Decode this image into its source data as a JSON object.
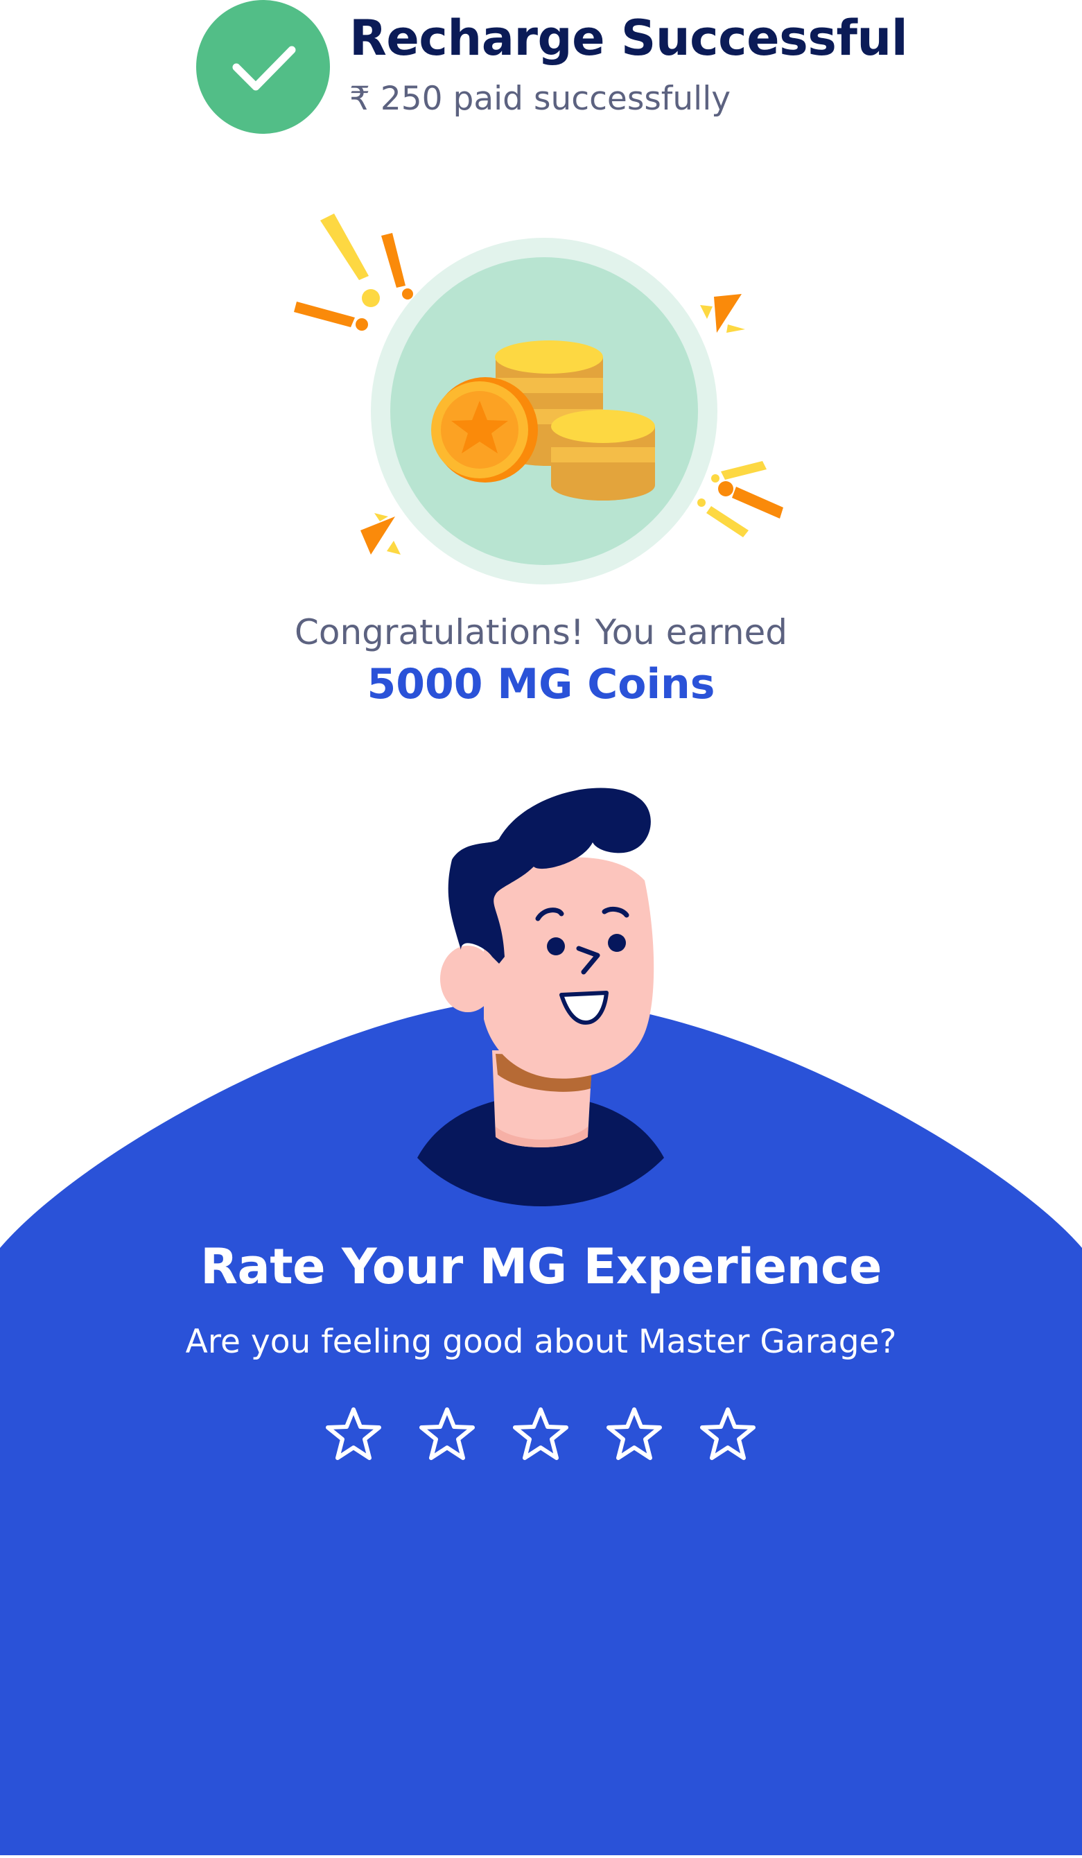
{
  "header": {
    "title": "Recharge Successful",
    "subtitle": "₹ 250 paid successfully",
    "icon": "check-circle-icon"
  },
  "reward": {
    "congrats_text": "Congratulations! You earned",
    "coins_text": "5000 MG Coins",
    "illustration": "coins-illustration"
  },
  "rating": {
    "title": "Rate Your MG Experience",
    "question": "Are you feeling good about Master Garage?",
    "max_stars": 5,
    "selected_stars": 0,
    "star_icon": "star-outline-icon"
  },
  "colors": {
    "success_green": "#52be87",
    "heading_navy": "#0b1b57",
    "text_gray": "#5c6280",
    "brand_blue": "#2a52d8"
  }
}
